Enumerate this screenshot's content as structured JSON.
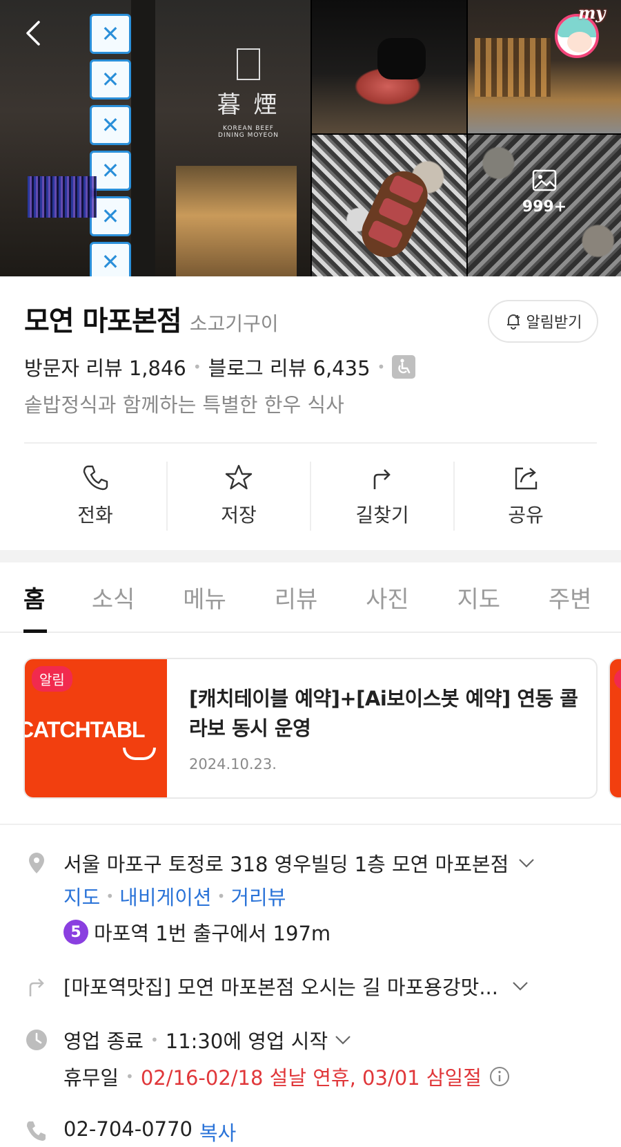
{
  "photos": {
    "more_count": "999+",
    "badge_text": "my"
  },
  "place": {
    "name": "모연 마포본점",
    "category": "소고기구이",
    "alarm_label": "알림받기",
    "visitor_reviews": "방문자 리뷰 1,846",
    "blog_reviews": "블로그 리뷰 6,435",
    "description": "솥밥정식과 함께하는 특별한 한우 식사"
  },
  "actions": [
    {
      "label": "전화",
      "icon": "phone-icon"
    },
    {
      "label": "저장",
      "icon": "star-icon"
    },
    {
      "label": "길찾기",
      "icon": "directions-icon"
    },
    {
      "label": "공유",
      "icon": "share-icon"
    }
  ],
  "tabs": [
    "홈",
    "소식",
    "메뉴",
    "리뷰",
    "사진",
    "지도",
    "주변"
  ],
  "notice": {
    "badge": "알림",
    "image_text": "CATCHTABL",
    "title": "[캐치테이블 예약]+[Ai보이스봇 예약] 연동 콜라보 동시 운영",
    "date": "2024.10.23."
  },
  "info": {
    "address": "서울 마포구 토정로 318 영우빌딩 1층 모연 마포본점",
    "links": [
      "지도",
      "내비게이션",
      "거리뷰"
    ],
    "subway_line": "5",
    "subway_text": "마포역 1번 출구에서 197m",
    "directions": "[마포역맛집] 모연 마포본점 오시는 길 마포용강맛...",
    "hours_status": "영업 종료",
    "hours_next": "11:30에 영업 시작",
    "holiday_label": "휴무일",
    "holiday_text": "02/16-02/18 설날 연휴, 03/01 삼일절",
    "phone": "02-704-0770",
    "copy_label": "복사"
  },
  "colors": {
    "accent_blue": "#2a73d8",
    "holiday_red": "#e0373a",
    "subway_line5": "#8a3fe0",
    "catchtable": "#f23f0f"
  }
}
